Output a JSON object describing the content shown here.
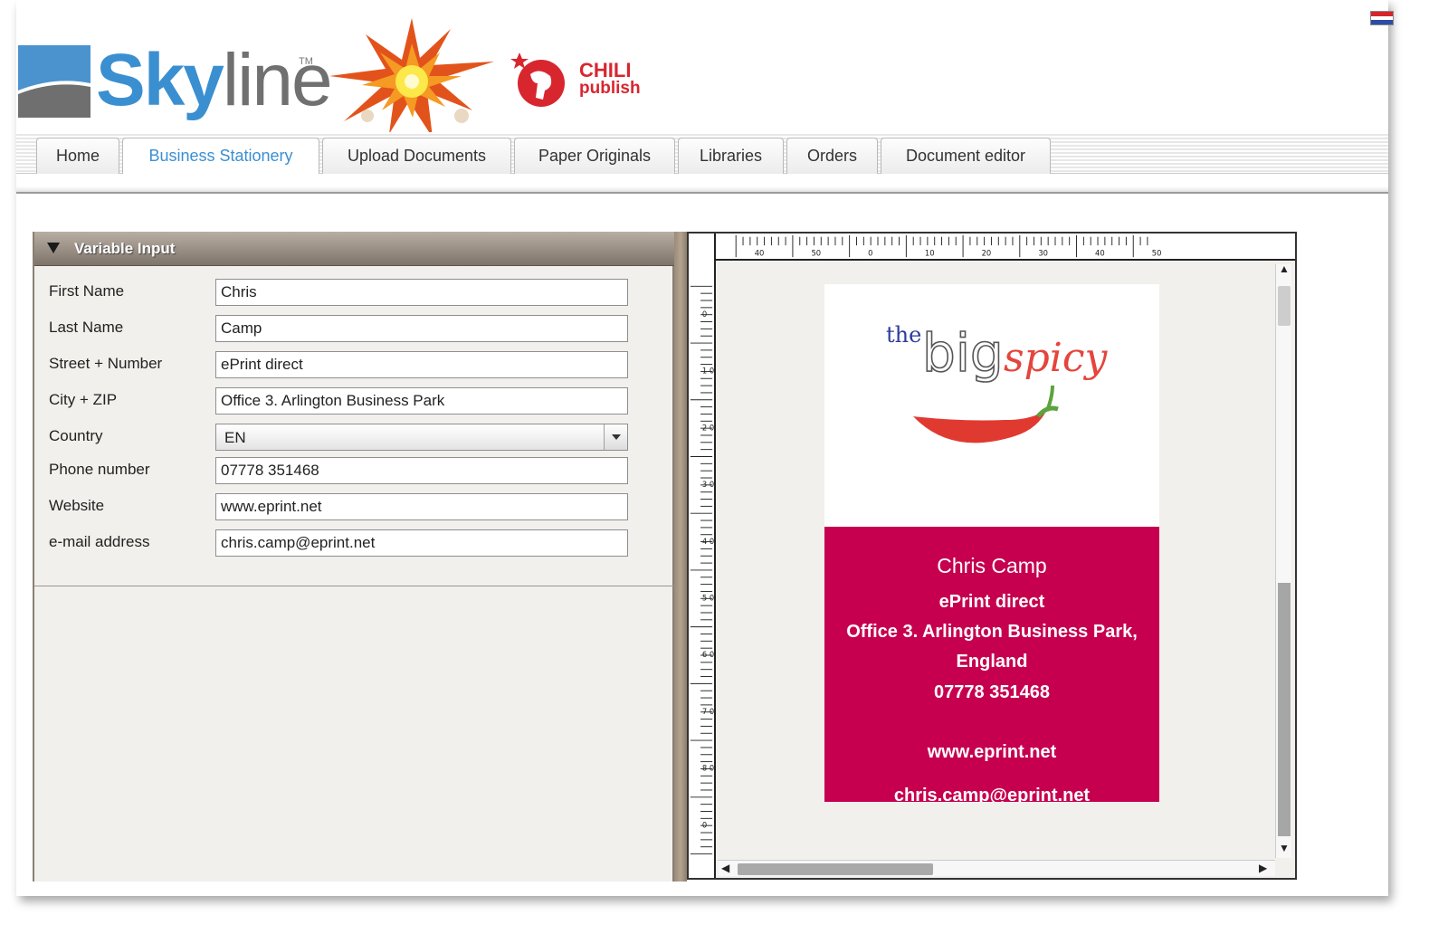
{
  "brand": {
    "skyline_bold": "Sky",
    "skyline_light": "line",
    "trademark": "TM",
    "chili_line1": "CHILI",
    "chili_line2": "publish"
  },
  "flag": {
    "colors": [
      "#d6242c",
      "#ffffff",
      "#2b4da3"
    ]
  },
  "tabs": [
    {
      "label": "Home",
      "active": false
    },
    {
      "label": "Business Stationery",
      "active": true
    },
    {
      "label": "Upload Documents",
      "active": false
    },
    {
      "label": "Paper Originals",
      "active": false
    },
    {
      "label": "Libraries",
      "active": false
    },
    {
      "label": "Orders",
      "active": false
    },
    {
      "label": "Document editor",
      "active": false
    }
  ],
  "panel": {
    "title": "Variable Input",
    "fields": {
      "first_name": {
        "label": "First Name",
        "value": "Chris"
      },
      "last_name": {
        "label": "Last Name",
        "value": "Camp"
      },
      "street": {
        "label": "Street + Number",
        "value": "ePrint direct"
      },
      "city": {
        "label": "City + ZIP",
        "value": "Office 3. Arlington Business Park"
      },
      "country": {
        "label": "Country",
        "value": "EN"
      },
      "phone": {
        "label": "Phone number",
        "value": "07778 351468"
      },
      "website": {
        "label": "Website",
        "value": "www.eprint.net"
      },
      "email": {
        "label": "e-mail address",
        "value": "chris.camp@eprint.net"
      }
    }
  },
  "ruler": {
    "top_labels": [
      "40",
      "50",
      "0",
      "10",
      "20",
      "30",
      "40",
      "50"
    ],
    "left_labels": [
      "0",
      "1 0",
      "2 0",
      "3 0",
      "4 0",
      "5 0",
      "6 0",
      "7 0",
      "8 0",
      "0"
    ]
  },
  "card": {
    "logo_the": "the",
    "logo_big": "big",
    "logo_spicy": "spicy",
    "name": "Chris Camp",
    "company": "ePrint direct",
    "address_line1": "Office 3. Arlington Business Park,",
    "address_line2": "England",
    "phone": "07778 351468",
    "website": "www.eprint.net",
    "email": "chris.camp@eprint.net",
    "accent_color": "#c6004f"
  }
}
